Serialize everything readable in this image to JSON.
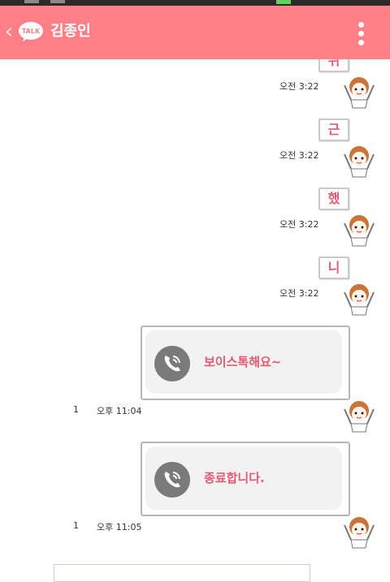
{
  "header": {
    "title": "김종인",
    "logo_text": "TALK",
    "back_icon": "chevron-left-icon",
    "menu_icon": "more-vertical-icon",
    "background": "#ff7f86"
  },
  "messages": [
    {
      "text": "뒤",
      "time": "오전 3:22"
    },
    {
      "text": "근",
      "time": "오전 3:22"
    },
    {
      "text": "했",
      "time": "오전 3:22"
    },
    {
      "text": "니",
      "time": "오전 3:22"
    }
  ],
  "voice_messages": [
    {
      "text": "보이스톡해요~",
      "unread": "1",
      "time": "오후 11:04"
    },
    {
      "text": "종료합니다.",
      "unread": "1",
      "time": "오후 11:05"
    }
  ],
  "colors": {
    "accent_text": "#e45a72",
    "bubble_border": "#c9c9c9"
  }
}
